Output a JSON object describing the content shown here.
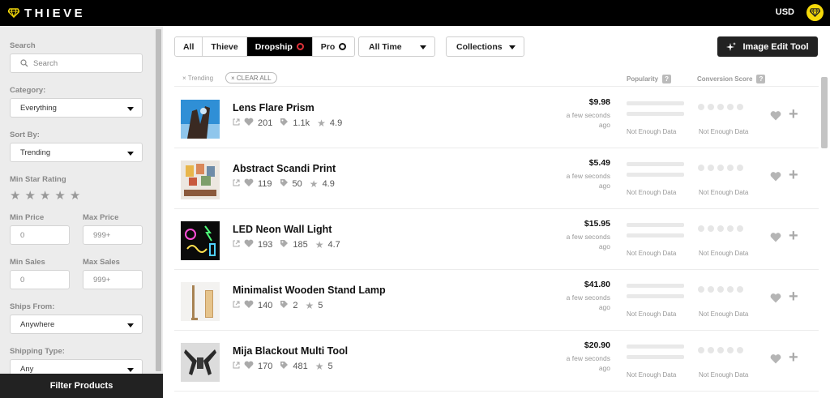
{
  "app": {
    "logo_text": "THIEVE",
    "currency": "USD"
  },
  "sidebar": {
    "search_label": "Search",
    "search_placeholder": "Search",
    "category_label": "Category:",
    "category_value": "Everything",
    "sort_label": "Sort By:",
    "sort_value": "Trending",
    "min_star_label": "Min Star Rating",
    "min_price_label": "Min Price",
    "max_price_label": "Max Price",
    "min_price_value": "0",
    "max_price_value": "999+",
    "min_sales_label": "Min Sales",
    "max_sales_label": "Max Sales",
    "min_sales_value": "0",
    "max_sales_value": "999+",
    "ships_from_label": "Ships From:",
    "ships_from_value": "Anywhere",
    "shipping_type_label": "Shipping Type:",
    "shipping_type_value": "Any",
    "filter_button": "Filter Products"
  },
  "toolbar": {
    "tabs": [
      {
        "label": "All"
      },
      {
        "label": "Thieve"
      },
      {
        "label": "Dropship"
      },
      {
        "label": "Pro"
      }
    ],
    "time_dropdown": "All Time",
    "collections_dropdown": "Collections",
    "edit_button": "Image Edit Tool"
  },
  "list_header": {
    "chip_trending": "× Trending",
    "chip_clear": "× CLEAR ALL",
    "popularity": "Popularity",
    "conversion": "Conversion Score",
    "q": "?"
  },
  "products": [
    {
      "name": "Lens Flare Prism",
      "likes": "201",
      "sales": "1.1k",
      "rating": "4.9",
      "price": "$9.98",
      "ago": "a few seconds ago",
      "pop": "Not Enough Data",
      "conv": "Not Enough Data"
    },
    {
      "name": "Abstract Scandi Print",
      "likes": "119",
      "sales": "50",
      "rating": "4.9",
      "price": "$5.49",
      "ago": "a few seconds ago",
      "pop": "Not Enough Data",
      "conv": "Not Enough Data"
    },
    {
      "name": "LED Neon Wall Light",
      "likes": "193",
      "sales": "185",
      "rating": "4.7",
      "price": "$15.95",
      "ago": "a few seconds ago",
      "pop": "Not Enough Data",
      "conv": "Not Enough Data"
    },
    {
      "name": "Minimalist Wooden Stand Lamp",
      "likes": "140",
      "sales": "2",
      "rating": "5",
      "price": "$41.80",
      "ago": "a few seconds ago",
      "pop": "Not Enough Data",
      "conv": "Not Enough Data"
    },
    {
      "name": "Mija Blackout Multi Tool",
      "likes": "170",
      "sales": "481",
      "rating": "5",
      "price": "$20.90",
      "ago": "a few seconds ago",
      "pop": "Not Enough Data",
      "conv": "Not Enough Data"
    }
  ],
  "colors": {
    "accent": "#f5d90a",
    "dark": "#222222",
    "red_ring": "#e0323a"
  }
}
